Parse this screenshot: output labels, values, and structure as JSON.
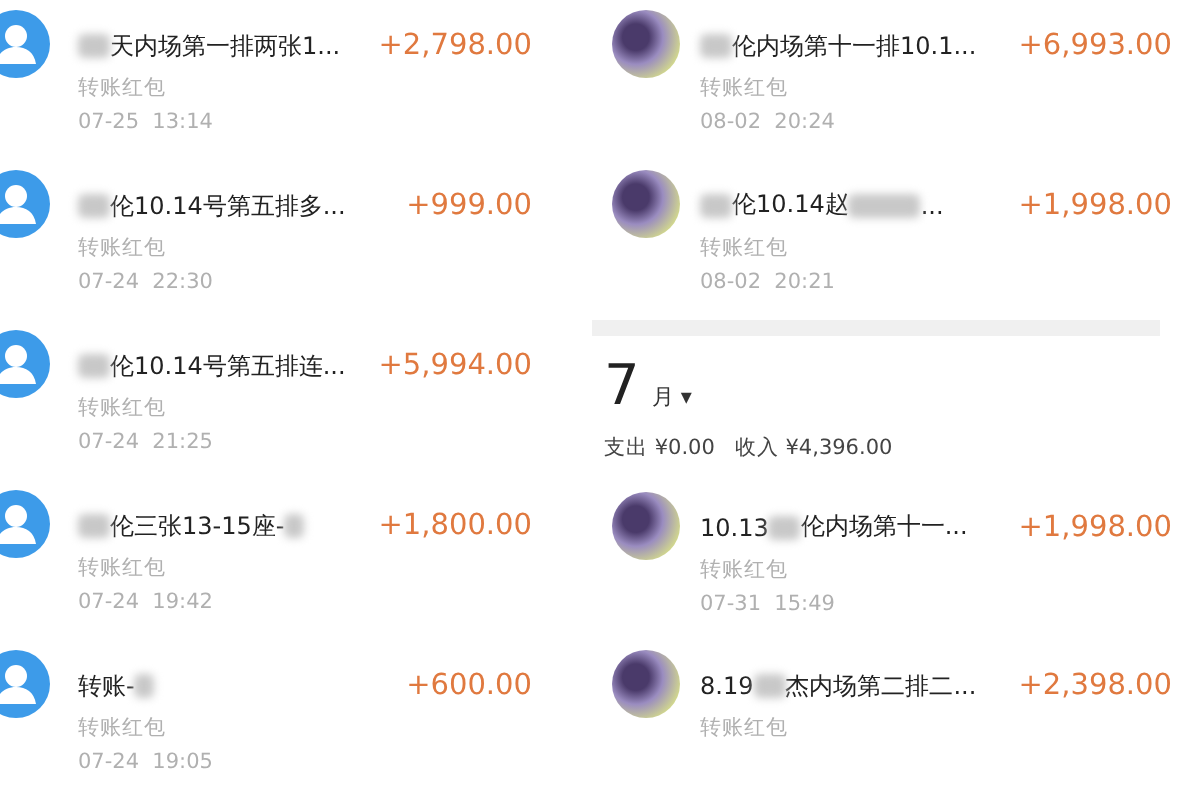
{
  "left_list": {
    "rows": [
      {
        "avatar": {
          "kind": "default"
        },
        "title": [
          {
            "kind": "redacted"
          },
          {
            "kind": "text",
            "text": "天内场第一排两张1..."
          }
        ],
        "subtitle": "转账红包",
        "time": "07-25  13:14",
        "amount": "+2,798.00"
      },
      {
        "avatar": {
          "kind": "default"
        },
        "title": [
          {
            "kind": "redacted"
          },
          {
            "kind": "text",
            "text": "伦10.14号第五排多..."
          }
        ],
        "subtitle": "转账红包",
        "time": "07-24  22:30",
        "amount": "+999.00"
      },
      {
        "avatar": {
          "kind": "default"
        },
        "title": [
          {
            "kind": "redacted"
          },
          {
            "kind": "text",
            "text": "伦10.14号第五排连..."
          }
        ],
        "subtitle": "转账红包",
        "time": "07-24  21:25",
        "amount": "+5,994.00"
      },
      {
        "avatar": {
          "kind": "default"
        },
        "title": [
          {
            "kind": "redacted"
          },
          {
            "kind": "text",
            "text": "伦三张13-15座-"
          },
          {
            "kind": "redacted_short"
          }
        ],
        "subtitle": "转账红包",
        "time": "07-24  19:42",
        "amount": "+1,800.00"
      },
      {
        "avatar": {
          "kind": "default"
        },
        "title": [
          {
            "kind": "text",
            "text": "转账-"
          },
          {
            "kind": "redacted_short"
          }
        ],
        "subtitle": "转账红包",
        "time": "07-24  19:05",
        "amount": "+600.00"
      }
    ]
  },
  "right_panel": {
    "rows": [
      {
        "avatar": {
          "kind": "photo"
        },
        "title": [
          {
            "kind": "redacted"
          },
          {
            "kind": "text",
            "text": "伦内场第十一排10.1..."
          }
        ],
        "subtitle": "转账红包",
        "time": "08-02  20:24",
        "amount": "+6,993.00"
      },
      {
        "avatar": {
          "kind": "photo"
        },
        "title": [
          {
            "kind": "redacted"
          },
          {
            "kind": "text",
            "text": "伦10.14赵"
          },
          {
            "kind": "redacted_long"
          },
          {
            "kind": "text",
            "text": "..."
          }
        ],
        "subtitle": "转账红包",
        "time": "08-02  20:21",
        "amount": "+1,998.00"
      }
    ],
    "month": {
      "number": "7",
      "unit": "月",
      "caret": "▾"
    },
    "summary": [
      "支出 ¥0.00",
      "收入 ¥4,396.00"
    ],
    "month_rows": [
      {
        "avatar": {
          "kind": "photo"
        },
        "title": [
          {
            "kind": "text",
            "text": "10.13"
          },
          {
            "kind": "redacted"
          },
          {
            "kind": "text",
            "text": "伦内场第十一..."
          }
        ],
        "subtitle": "转账红包",
        "time": "07-31  15:49",
        "amount": "+1,998.00"
      },
      {
        "avatar": {
          "kind": "photo"
        },
        "title": [
          {
            "kind": "text",
            "text": "8.19"
          },
          {
            "kind": "redacted"
          },
          {
            "kind": "text",
            "text": "杰内场第二排二..."
          }
        ],
        "subtitle": "转账红包",
        "amount": "+2,398.00"
      }
    ]
  }
}
